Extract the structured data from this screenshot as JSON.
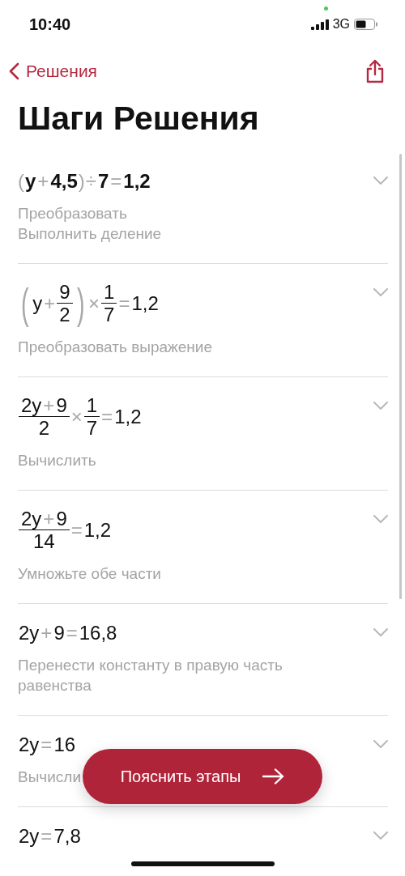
{
  "status_bar": {
    "time": "10:40",
    "network": "3G"
  },
  "nav": {
    "back_label": "Решения"
  },
  "title": "Шаги Решения",
  "steps": [
    {
      "highlighted": true,
      "expanded": false,
      "expression": [
        {
          "kind": "paren",
          "text": "("
        },
        {
          "kind": "num",
          "text": "y"
        },
        {
          "kind": "op",
          "text": "+"
        },
        {
          "kind": "num",
          "text": "4,5"
        },
        {
          "kind": "paren",
          "text": ")"
        },
        {
          "kind": "op",
          "text": "÷"
        },
        {
          "kind": "num",
          "text": "7"
        },
        {
          "kind": "op",
          "text": "="
        },
        {
          "kind": "num",
          "text": "1,2"
        }
      ],
      "description": [
        "Преобразовать",
        "Выполнить деление"
      ]
    },
    {
      "highlighted": false,
      "expanded": false,
      "expression": [
        {
          "kind": "paren",
          "text": "("
        },
        {
          "kind": "num",
          "text": "y"
        },
        {
          "kind": "op",
          "text": "+"
        },
        {
          "kind": "frac",
          "num": [
            {
              "kind": "num",
              "text": "9"
            }
          ],
          "den": [
            {
              "kind": "num",
              "text": "2"
            }
          ]
        },
        {
          "kind": "paren",
          "text": ")"
        },
        {
          "kind": "op",
          "text": "×"
        },
        {
          "kind": "frac",
          "num": [
            {
              "kind": "num",
              "text": "1"
            }
          ],
          "den": [
            {
              "kind": "num",
              "text": "7"
            }
          ]
        },
        {
          "kind": "op",
          "text": "="
        },
        {
          "kind": "num",
          "text": "1,2"
        }
      ],
      "description": [
        "Преобразовать выражение"
      ]
    },
    {
      "highlighted": false,
      "expanded": false,
      "expression": [
        {
          "kind": "frac",
          "num": [
            {
              "kind": "num",
              "text": "2y"
            },
            {
              "kind": "op",
              "text": "+"
            },
            {
              "kind": "num",
              "text": "9"
            }
          ],
          "den": [
            {
              "kind": "num",
              "text": "2"
            }
          ]
        },
        {
          "kind": "op",
          "text": "×"
        },
        {
          "kind": "frac",
          "num": [
            {
              "kind": "num",
              "text": "1"
            }
          ],
          "den": [
            {
              "kind": "num",
              "text": "7"
            }
          ]
        },
        {
          "kind": "op",
          "text": "="
        },
        {
          "kind": "num",
          "text": "1,2"
        }
      ],
      "description": [
        "Вычислить"
      ]
    },
    {
      "highlighted": false,
      "expanded": false,
      "expression": [
        {
          "kind": "frac",
          "num": [
            {
              "kind": "num",
              "text": "2y"
            },
            {
              "kind": "op",
              "text": "+"
            },
            {
              "kind": "num",
              "text": "9"
            }
          ],
          "den": [
            {
              "kind": "num",
              "text": "14"
            }
          ]
        },
        {
          "kind": "op",
          "text": "="
        },
        {
          "kind": "num",
          "text": "1,2"
        }
      ],
      "description": [
        "Умножьте обе части"
      ]
    },
    {
      "highlighted": false,
      "expanded": false,
      "expression": [
        {
          "kind": "num",
          "text": "2y"
        },
        {
          "kind": "op",
          "text": "+"
        },
        {
          "kind": "num",
          "text": "9"
        },
        {
          "kind": "op",
          "text": "="
        },
        {
          "kind": "num",
          "text": "16,8"
        }
      ],
      "description": [
        "Перенести константу в правую часть равенства"
      ]
    },
    {
      "highlighted": false,
      "expanded": false,
      "expression": [
        {
          "kind": "num",
          "text": "2y"
        },
        {
          "kind": "op",
          "text": "="
        },
        {
          "kind": "num",
          "text": "16"
        }
      ],
      "description": [
        "Вычисли"
      ]
    },
    {
      "highlighted": false,
      "expanded": false,
      "expression": [
        {
          "kind": "num",
          "text": "2y"
        },
        {
          "kind": "op",
          "text": "="
        },
        {
          "kind": "num",
          "text": "7,8"
        }
      ]
    }
  ],
  "action_button": {
    "label": "Пояснить этапы"
  }
}
